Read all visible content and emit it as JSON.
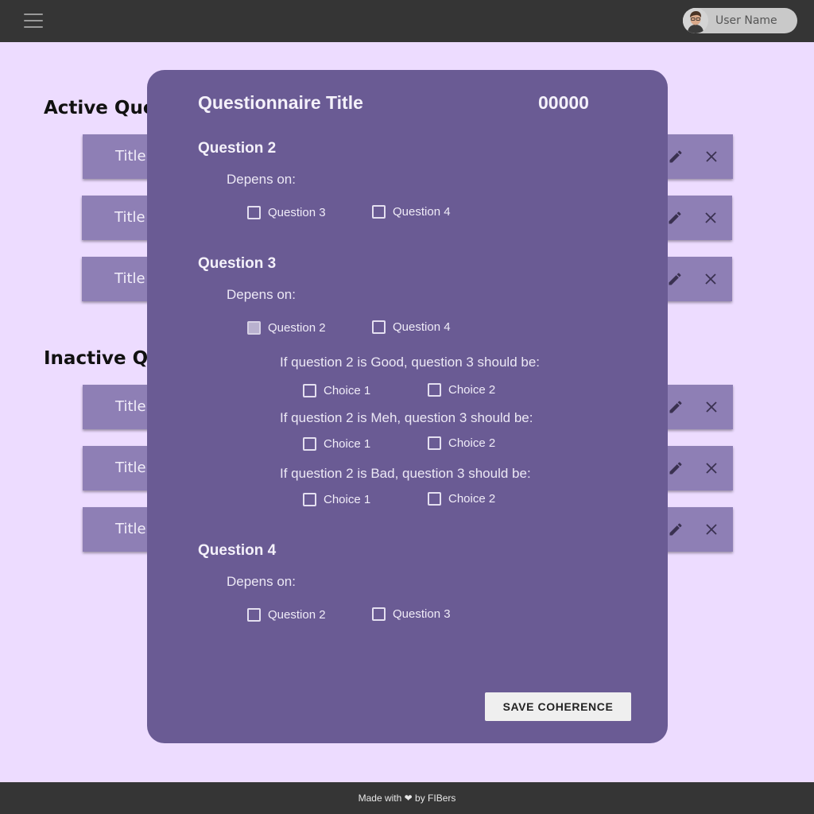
{
  "header": {
    "user_name": "User Name"
  },
  "lists": {
    "active_heading": "Active Questionnaires",
    "inactive_heading": "Inactive Questionnaires",
    "active_items": [
      {
        "title": "Title"
      },
      {
        "title": "Title"
      },
      {
        "title": "Title"
      }
    ],
    "inactive_items": [
      {
        "title": "Title"
      },
      {
        "title": "Title"
      },
      {
        "title": "Title"
      }
    ]
  },
  "modal": {
    "title": "Questionnaire Title",
    "id": "00000",
    "depends_label": "Depens on:",
    "questions": [
      {
        "name": "Question 2",
        "depends_on": [
          {
            "label": "Question 3",
            "checked": false
          },
          {
            "label": "Question 4",
            "checked": false
          }
        ]
      },
      {
        "name": "Question 3",
        "depends_on": [
          {
            "label": "Question 2",
            "checked": true
          },
          {
            "label": "Question 4",
            "checked": false
          }
        ],
        "conditions": [
          {
            "text": "If question 2 is Good, question 3 should be:",
            "choices": [
              "Choice 1",
              "Choice 2"
            ]
          },
          {
            "text": "If question 2 is Meh, question 3 should be:",
            "choices": [
              "Choice 1",
              "Choice 2"
            ]
          },
          {
            "text": "If question 2 is Bad, question 3 should be:",
            "choices": [
              "Choice 1",
              "Choice 2"
            ]
          }
        ]
      },
      {
        "name": "Question 4",
        "depends_on": [
          {
            "label": "Question 2",
            "checked": false
          },
          {
            "label": "Question 3",
            "checked": false
          }
        ]
      }
    ],
    "save_label": "SAVE COHERENCE"
  },
  "footer": {
    "text": "Made with ❤ by FIBers"
  },
  "icons": {
    "menu": "menu-icon",
    "edit": "pencil-icon",
    "close": "close-icon",
    "heart": "heart-icon"
  },
  "colors": {
    "topbar": "#353535",
    "background": "#eddcff",
    "row": "#8e7fb5",
    "modal": "#6a5b94",
    "button": "#efefef"
  }
}
